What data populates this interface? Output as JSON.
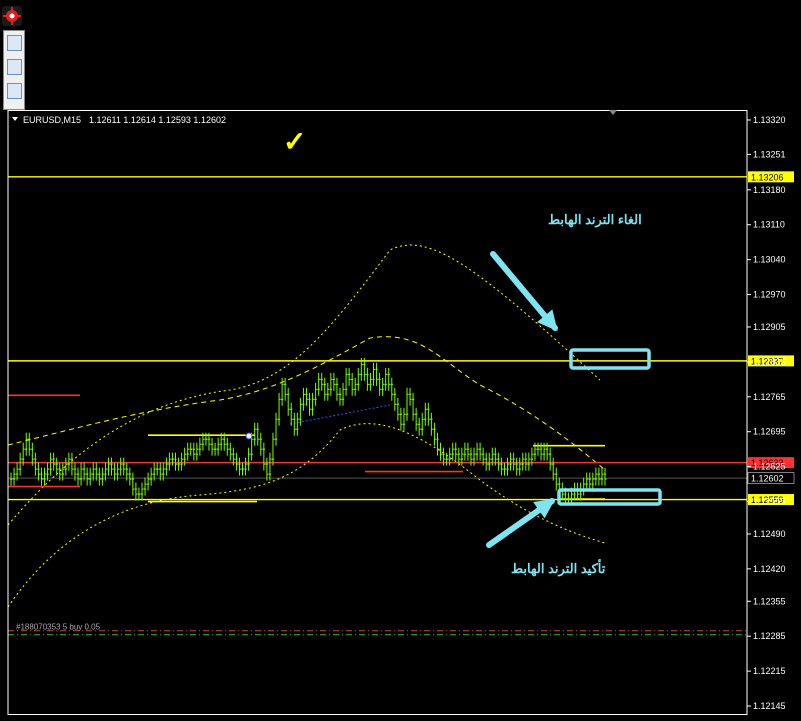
{
  "header": {
    "symbol_tf": "EURUSD,M15",
    "ohlc": "1.12611 1.12614 1.12593 1.12602"
  },
  "annotations": {
    "top_text": "الغاء الترند الهابط",
    "bottom_text": "تأكيد الترند الهابط",
    "check": "✓",
    "order_label": "#188070353 5 buy 0.05"
  },
  "colors": {
    "bg": "#000000",
    "candle": "#7CFC00",
    "level": "#FFFF00",
    "red": "#FF3030",
    "cyan": "#7FE3F0",
    "grid": "#FFFFFF"
  },
  "chart_data": {
    "type": "line",
    "symbol": "EURUSD",
    "timeframe": "M15",
    "ylim": [
      1.12125,
      1.1334
    ],
    "y_ticks": [
      1.1332,
      1.13251,
      1.1318,
      1.1311,
      1.1304,
      1.1297,
      1.12905,
      1.12835,
      1.12765,
      1.12695,
      1.12625,
      1.12555,
      1.1249,
      1.1242,
      1.12355,
      1.12285,
      1.12215,
      1.12145
    ],
    "levels": [
      {
        "price": "1.13206",
        "value": 1.13206,
        "color": "#FFFF00"
      },
      {
        "price": "1.12837",
        "value": 1.12837,
        "color": "#FFFF00"
      },
      {
        "price": "1.12633",
        "value": 1.12633,
        "color": "#FF3030"
      },
      {
        "price": "1.12602",
        "value": 1.12602,
        "color": "#000000"
      },
      {
        "price": "1.12559",
        "value": 1.12559,
        "color": "#FFFF00"
      }
    ],
    "order_level": 1.1229,
    "closes": [
      1.126,
      1.1261,
      1.1262,
      1.1264,
      1.1266,
      1.1268,
      1.1266,
      1.1264,
      1.1262,
      1.1261,
      1.126,
      1.1261,
      1.1262,
      1.1264,
      1.1263,
      1.1262,
      1.1261,
      1.1262,
      1.1263,
      1.1264,
      1.1262,
      1.1261,
      1.126,
      1.1262,
      1.1261,
      1.126,
      1.1261,
      1.1262,
      1.1261,
      1.126,
      1.1261,
      1.1262,
      1.1263,
      1.1262,
      1.1261,
      1.1262,
      1.1263,
      1.1262,
      1.1261,
      1.126,
      1.1258,
      1.1257,
      1.1257,
      1.1258,
      1.1259,
      1.126,
      1.1261,
      1.1262,
      1.1262,
      1.1261,
      1.1262,
      1.1263,
      1.1264,
      1.1264,
      1.1263,
      1.1263,
      1.1264,
      1.1265,
      1.1266,
      1.1266,
      1.1265,
      1.1266,
      1.1267,
      1.1268,
      1.1268,
      1.1267,
      1.1266,
      1.1266,
      1.1267,
      1.1268,
      1.1267,
      1.1266,
      1.1265,
      1.1264,
      1.1263,
      1.1262,
      1.1262,
      1.1263,
      1.1265,
      1.1268,
      1.127,
      1.1268,
      1.1266,
      1.1263,
      1.1261,
      1.1264,
      1.1268,
      1.1272,
      1.1276,
      1.1279,
      1.1277,
      1.1274,
      1.1272,
      1.127,
      1.1272,
      1.1275,
      1.1277,
      1.1276,
      1.1274,
      1.1276,
      1.1278,
      1.128,
      1.1279,
      1.1277,
      1.1278,
      1.128,
      1.1279,
      1.1277,
      1.1276,
      1.1278,
      1.1281,
      1.128,
      1.1278,
      1.1279,
      1.1281,
      1.1283,
      1.1281,
      1.1279,
      1.128,
      1.1282,
      1.128,
      1.1278,
      1.1279,
      1.1281,
      1.1279,
      1.1277,
      1.1275,
      1.1273,
      1.1271,
      1.1273,
      1.1277,
      1.1276,
      1.1273,
      1.1271,
      1.127,
      1.1272,
      1.1274,
      1.1272,
      1.127,
      1.1268,
      1.1266,
      1.1265,
      1.1264,
      1.1264,
      1.1265,
      1.1266,
      1.1265,
      1.1264,
      1.1265,
      1.1266,
      1.1265,
      1.1264,
      1.1265,
      1.1266,
      1.1265,
      1.1264,
      1.1263,
      1.1264,
      1.1265,
      1.1264,
      1.1263,
      1.1262,
      1.1262,
      1.1263,
      1.1264,
      1.1263,
      1.1262,
      1.1263,
      1.1264,
      1.1263,
      1.1264,
      1.1265,
      1.1266,
      1.1266,
      1.1265,
      1.1266,
      1.1265,
      1.1263,
      1.1261,
      1.1259,
      1.1258,
      1.1257,
      1.1256,
      1.1256,
      1.1257,
      1.1258,
      1.1257,
      1.1258,
      1.1259,
      1.126,
      1.1259,
      1.126,
      1.1261,
      1.126,
      1.1261,
      1.126
    ]
  }
}
